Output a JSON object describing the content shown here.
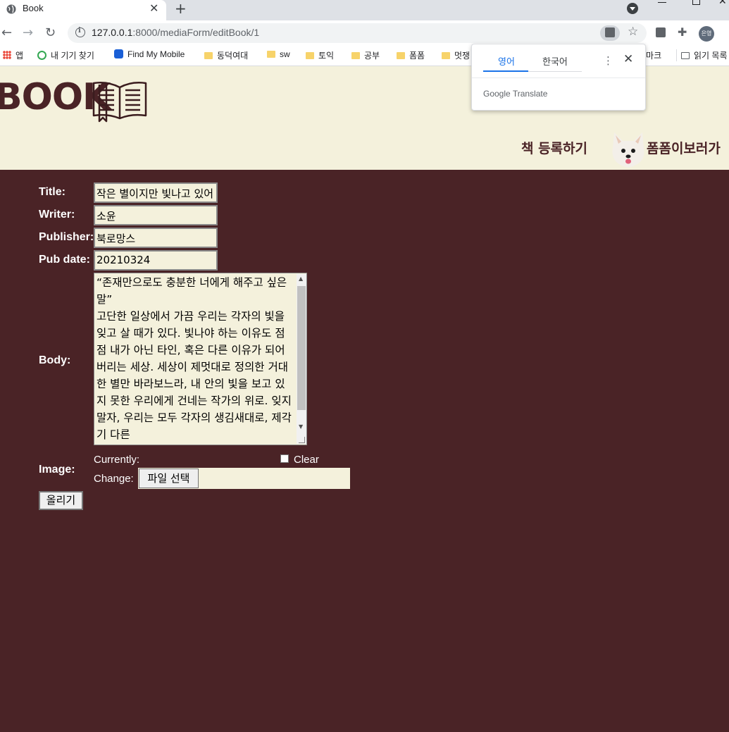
{
  "browser": {
    "tab_title": "Book",
    "url_host": "127.0.0.1",
    "url_path": ":8000/mediaForm/editBook/1",
    "profile_label": "은영",
    "bookmarks": [
      {
        "label": "앱",
        "icon": "apps-icon"
      },
      {
        "label": "내 기기 찾기",
        "icon": "find-device-icon"
      },
      {
        "label": "Find My Mobile",
        "icon": "find-my-mobile-icon"
      },
      {
        "label": "동덕여대",
        "icon": "folder-icon"
      },
      {
        "label": "sw",
        "icon": "folder-icon"
      },
      {
        "label": "토익",
        "icon": "folder-icon"
      },
      {
        "label": "공부",
        "icon": "folder-icon"
      },
      {
        "label": "폼폼",
        "icon": "folder-icon"
      },
      {
        "label": "멋쟁",
        "icon": "folder-icon"
      },
      {
        "label": "북마크",
        "icon": "folder-icon"
      },
      {
        "label": "읽기 목록",
        "icon": "reading-list-icon"
      }
    ]
  },
  "translate_popup": {
    "tab_source": "영어",
    "tab_target": "한국어",
    "brand": "Google Translate"
  },
  "site": {
    "logo_text": "BOOK",
    "nav_add_book": "책 등록하기",
    "nav_pompom": "폼폼이보러가"
  },
  "form": {
    "title_label": "Title:",
    "title_value": "작은 별이지만 빛나고 있어",
    "writer_label": "Writer:",
    "writer_value": "소윤",
    "publisher_label": "Publisher:",
    "publisher_value": "북로망스",
    "pubdate_label": "Pub date:",
    "pubdate_value": "20210324",
    "body_label": "Body:",
    "body_value": "“존재만으로도 충분한 너에게 해주고 싶은 말”\n고단한 일상에서 가끔 우리는 각자의 빛을 잊고 살 때가 있다. 빛나야 하는 이유도 점점 내가 아닌 타인, 혹은 다른 이유가 되어버리는 세상. 세상이 제멋대로 정의한 거대한 별만 바라보느라, 내 안의 빛을 보고 있지 못한 우리에게 건네는 작가의 위로. 잊지 말자, 우리는 모두 각자의 생김새대로, 제각기 다른",
    "image_label": "Image:",
    "currently_label": "Currently:",
    "clear_label": "Clear",
    "change_label": "Change:",
    "file_button": "파일 선택",
    "submit_button": "올리기"
  }
}
